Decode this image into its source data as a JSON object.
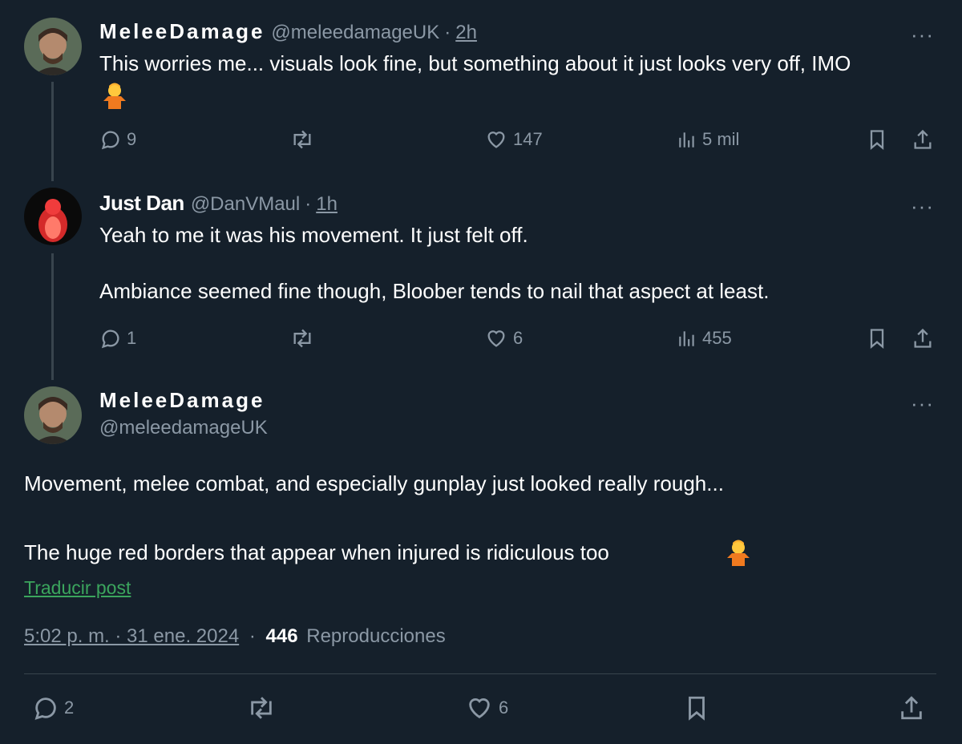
{
  "tweet1": {
    "name": "MeleeDamage",
    "handle": "@meleedamageUK",
    "time": "2h",
    "text": "This worries me... visuals look fine, but something about it just looks very off, IMO",
    "replies": "9",
    "likes": "147",
    "views": "5 mil"
  },
  "tweet2": {
    "name": "Just Dan",
    "handle": "@DanVMaul",
    "time": "1h",
    "text_line1": "Yeah to me it was his movement. It just felt off.",
    "text_line2": "Ambiance seemed fine though, Bloober tends to nail that aspect at least.",
    "replies": "1",
    "likes": "6",
    "views": "455"
  },
  "main_tweet": {
    "name": "MeleeDamage",
    "handle": "@meleedamageUK",
    "text_line1": "Movement, melee combat, and especially gunplay just looked really rough...",
    "text_line2": "The huge red borders that appear when injured is ridiculous too",
    "translate": "Traducir post",
    "timestamp": "5:02 p. m. · 31 ene. 2024",
    "views_count": "446",
    "views_label": "Reproducciones",
    "replies": "2",
    "likes": "6"
  },
  "separator": "·",
  "more": "···"
}
